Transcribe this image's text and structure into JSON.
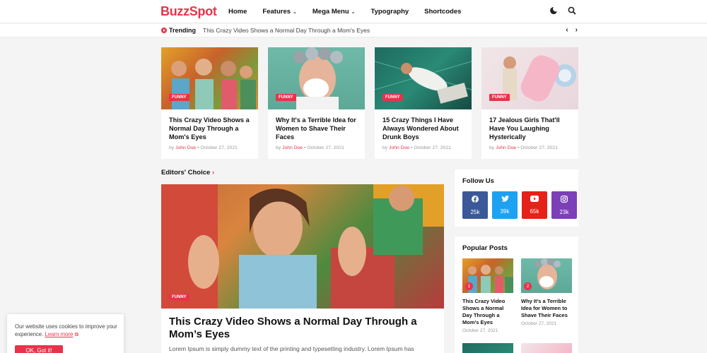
{
  "header": {
    "logo": "BuzzSpot",
    "nav": [
      {
        "label": "Home",
        "dropdown": false
      },
      {
        "label": "Features",
        "dropdown": true
      },
      {
        "label": "Mega Menu",
        "dropdown": true
      },
      {
        "label": "Typography",
        "dropdown": false
      },
      {
        "label": "Shortcodes",
        "dropdown": false
      }
    ],
    "icons": [
      "dark-mode-icon",
      "search-icon"
    ]
  },
  "trending": {
    "label": "Trending",
    "headline": "This Crazy Video Shows a Normal Day Through a Mom's Eyes"
  },
  "cards": [
    {
      "badge": "Funny",
      "title": "This Crazy Video Shows a Normal Day Through a Mom's Eyes",
      "by": "by",
      "author": "John Doe",
      "date": "October 27, 2021"
    },
    {
      "badge": "Funny",
      "title": "Why It's a Terrible Idea for Women to Shave Their Faces",
      "by": "by",
      "author": "John Doe",
      "date": "October 27, 2021"
    },
    {
      "badge": "Funny",
      "title": "15 Crazy Things I Have Always Wondered About Drunk Boys",
      "by": "by",
      "author": "John Doe",
      "date": "October 27, 2021"
    },
    {
      "badge": "Funny",
      "title": "17 Jealous Girls That'll Have You Laughing Hysterically",
      "by": "by",
      "author": "John Doe",
      "date": "October 27, 2021"
    }
  ],
  "editors": {
    "title": "Editors' Choice",
    "badge": "Funny",
    "feature_title": "This Crazy Video Shows a Normal Day Through a Mom’s Eyes",
    "excerpt": "Lorem Ipsum is simply dummy text of the printing and typesetting industry. Lorem Ipsum has"
  },
  "follow": {
    "title": "Follow Us",
    "socials": [
      {
        "icon": "facebook-icon",
        "count": "25k",
        "color": "#3b5998"
      },
      {
        "icon": "twitter-icon",
        "count": "39k",
        "color": "#1da1f2"
      },
      {
        "icon": "youtube-icon",
        "count": "65k",
        "color": "#e62117"
      },
      {
        "icon": "instagram-icon",
        "count": "23k",
        "color": "#7c3fb8"
      }
    ]
  },
  "popular": {
    "title": "Popular Posts",
    "posts": [
      {
        "num": "1",
        "title": "This Crazy Video Shows a Normal Day Through a Mom's Eyes",
        "date": "October 27, 2021"
      },
      {
        "num": "2",
        "title": "Why It's a Terrible Idea for Women to Shave Their Faces",
        "date": "October 27, 2021"
      }
    ]
  },
  "cookie": {
    "text": "Our website uses cookies to improve your experience.",
    "link": "Learn more",
    "button": "OK, Got it!"
  },
  "colors": {
    "accent": "#e8334a"
  }
}
